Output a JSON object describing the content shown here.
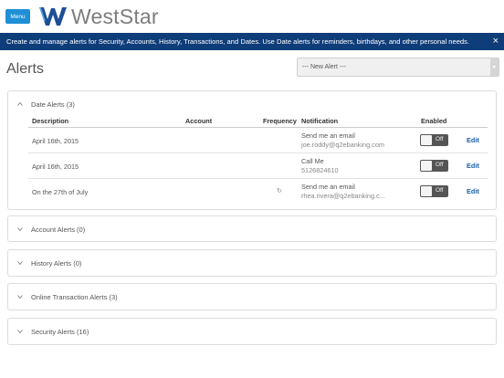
{
  "header": {
    "menu_label": "Menu",
    "brand_name": "WestStar"
  },
  "banner": {
    "text": "Create and manage alerts for Security, Accounts, History, Transactions, and Dates. Use Date alerts for reminders, birthdays, and other personal needs.",
    "close_glyph": "×"
  },
  "page": {
    "title": "Alerts",
    "new_alert_label": "--- New Alert ---"
  },
  "date_alerts": {
    "title": "Date Alerts (3)",
    "columns": {
      "description": "Description",
      "account": "Account",
      "frequency": "Frequency",
      "notification": "Notification",
      "enabled": "Enabled"
    },
    "rows": [
      {
        "description": "April 16th, 2015",
        "frequency": "",
        "notif_type": "Send me an email",
        "notif_target": "joe.roddy@q2ebanking.com",
        "enabled": "Off",
        "edit": "Edit"
      },
      {
        "description": "April 16th, 2015",
        "frequency": "",
        "notif_type": "Call Me",
        "notif_target": "5126824610",
        "enabled": "Off",
        "edit": "Edit"
      },
      {
        "description": "On the 27th of July",
        "frequency": "↻",
        "notif_type": "Send me an email",
        "notif_target": "rhea.rivera@q2ebanking.c...",
        "enabled": "Off",
        "edit": "Edit"
      }
    ]
  },
  "sections": {
    "account": "Account Alerts (0)",
    "history": "History Alerts (0)",
    "online": "Online Transaction Alerts (3)",
    "security": "Security Alerts (16)"
  },
  "colors": {
    "accent": "#1f8fd6",
    "banner": "#0f3d7a",
    "link": "#1a5fa8"
  }
}
